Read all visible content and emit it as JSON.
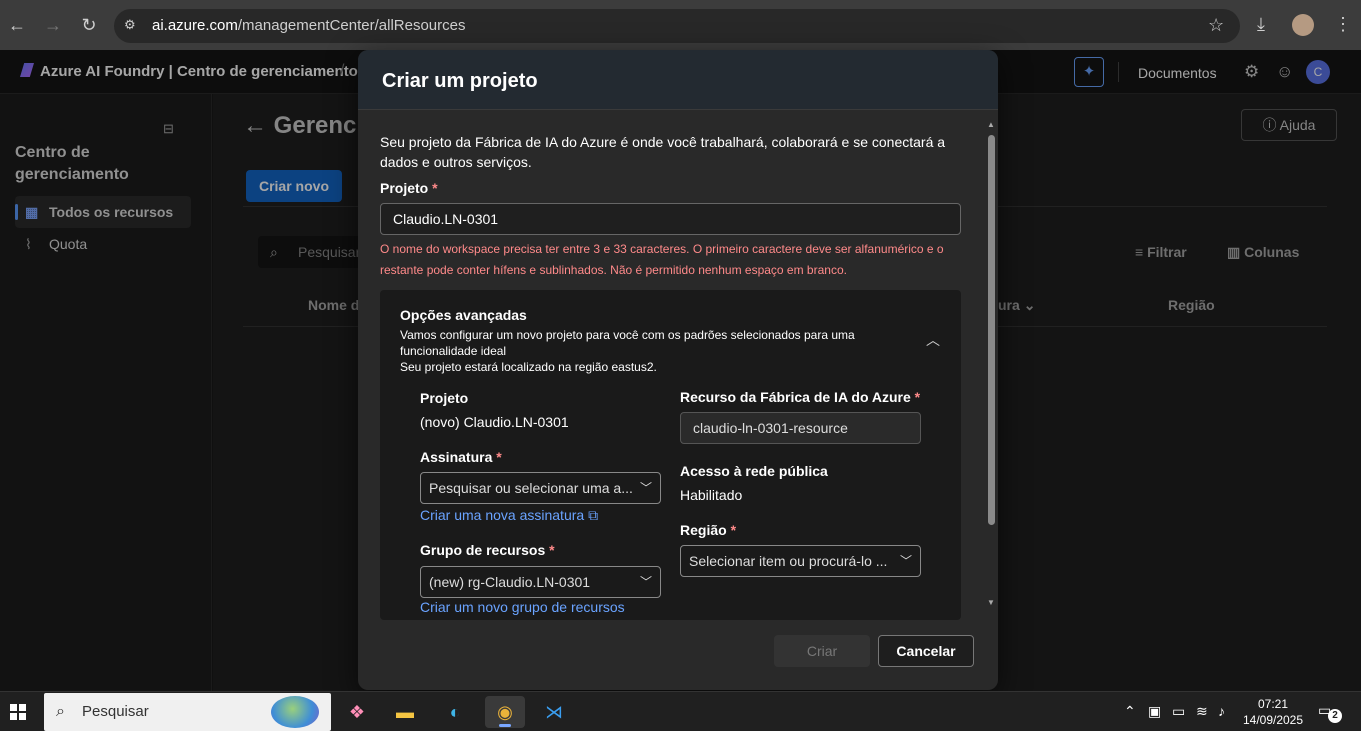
{
  "browser": {
    "url_domain": "ai.azure.com",
    "url_path": "/managementCenter/allResources"
  },
  "header": {
    "brand": "Azure AI Foundry | Centro de gerenciamento",
    "docs": "Documentos",
    "user_initial": "C"
  },
  "sidebar": {
    "title": "Centro de gerenciamento",
    "items": [
      {
        "label": "Todos os recursos",
        "icon": "grid-icon",
        "active": true
      },
      {
        "label": "Quota",
        "icon": "pulse-icon",
        "active": false
      }
    ]
  },
  "main": {
    "title": "Gerencia",
    "help": "Ajuda",
    "create_new": "Criar novo",
    "search_placeholder": "Pesquisar",
    "filter": "Filtrar",
    "columns": "Colunas",
    "col_name": "Nome d",
    "col_partial": "ura",
    "col_region": "Região"
  },
  "modal": {
    "title": "Criar um projeto",
    "intro": "Seu projeto da Fábrica de IA do Azure é onde você trabalhará, colaborará e se conectará a dados e outros serviços.",
    "project_label": "Projeto",
    "project_value": "Claudio.LN-0301",
    "error": "O nome do workspace precisa ter entre 3 e 33 caracteres. O primeiro caractere deve ser alfanumérico e o restante pode conter hífens e sublinhados. Não é permitido nenhum espaço em branco.",
    "advanced": {
      "title": "Opções avançadas",
      "desc_line1": "Vamos configurar um novo projeto para você com os padrões selecionados para uma funcionalidade ideal",
      "desc_line2": "Seu projeto estará localizado na região eastus2.",
      "project_label": "Projeto",
      "project_value": "(novo) Claudio.LN-0301",
      "resource_label": "Recurso da Fábrica de IA do Azure",
      "resource_value": "claudio-ln-0301-resource",
      "subscription_label": "Assinatura",
      "subscription_placeholder": "Pesquisar ou selecionar uma a...",
      "new_subscription_link": "Criar uma nova assinatura",
      "public_access_label": "Acesso à rede pública",
      "public_access_value": "Habilitado",
      "region_label": "Região",
      "region_placeholder": "Selecionar item ou procurá-lo ...",
      "rg_label": "Grupo de recursos",
      "rg_value": "(new) rg-Claudio.LN-0301",
      "new_rg_link": "Criar um novo grupo de recursos"
    },
    "create": "Criar",
    "cancel": "Cancelar"
  },
  "taskbar": {
    "search": "Pesquisar",
    "time": "07:21",
    "date": "14/09/2025",
    "notif_count": "2"
  }
}
